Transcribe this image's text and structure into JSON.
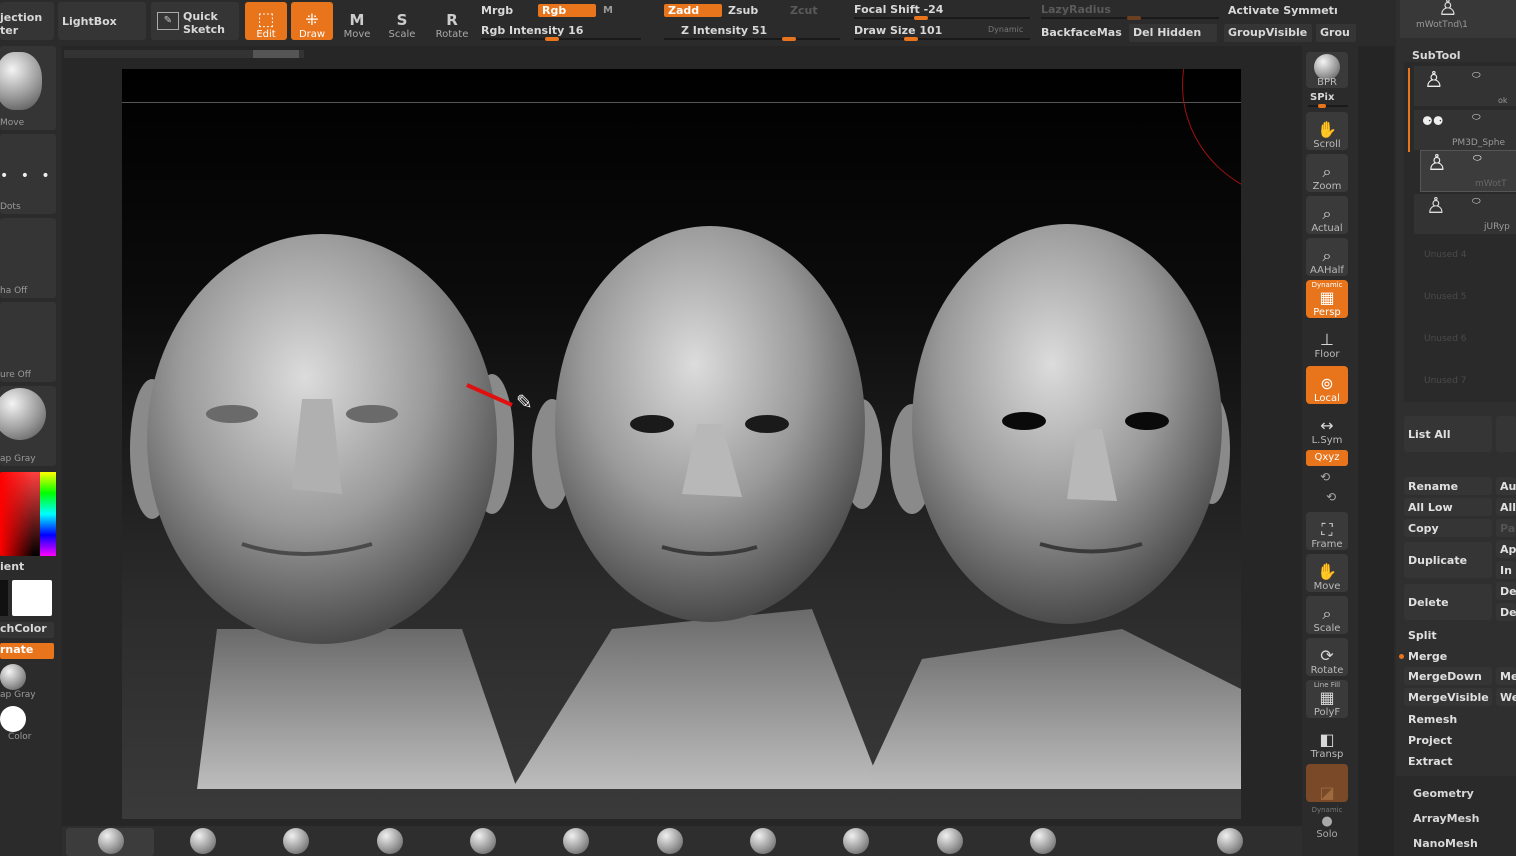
{
  "top_toolbar": {
    "projection_label": "jection",
    "projection_sub": "ter",
    "lightbox": "LightBox",
    "quick_sketch_line1": "Quick",
    "quick_sketch_line2": "Sketch",
    "edit": "Edit",
    "draw": "Draw",
    "move": "Move",
    "scale": "Scale",
    "rotate": "Rotate",
    "mrgb": "Mrgb",
    "rgb": "Rgb",
    "m": "M",
    "rgb_intensity": "Rgb  Intensity 16",
    "zadd": "Zadd",
    "zsub": "Zsub",
    "zcut": "Zcut",
    "z_intensity": "Z  Intensity 51",
    "focal_shift": "Focal  Shift -24",
    "draw_size": "Draw  Size 101",
    "dynamic": "Dynamic",
    "lazy_radius": "LazyRadius",
    "backface": "BackfaceMas",
    "del_hidden": "Del  Hidden",
    "activate_symmetry": "Activate  Symmetı",
    "group_visible": "GroupVisible",
    "grou": "Grou",
    "rgb_intensity_value": 16,
    "z_intensity_value": 51,
    "focal_shift_value": -24,
    "draw_size_value": 101
  },
  "left_panel": {
    "move_label": "Move",
    "dots_label": "Dots",
    "alpha_off": "ha  Off",
    "texture_off": "ure  Off",
    "matcap_gray": "ap  Gray",
    "gradient": "ient",
    "switch_color": "chColor",
    "alternate": "rnate",
    "matcap_gray2": "ap  Gray",
    "color": "Color"
  },
  "right_tools": {
    "bpr": "BPR",
    "spix": "SPix",
    "scroll": "Scroll",
    "zoom": "Zoom",
    "actual": "Actual",
    "aahalf": "AAHalf",
    "dynamic": "Dynamic",
    "persp": "Persp",
    "floor": "Floor",
    "local": "Local",
    "lsym": "L.Sym",
    "xyz": "Qxyz",
    "frame": "Frame",
    "move": "Move",
    "scale": "Scale",
    "rotate": "Rotate",
    "line_fill": "Line Fill",
    "polyf": "PolyF",
    "transp": "Transp",
    "dynamic2": "Dynamic",
    "solo": "Solo"
  },
  "subtool": {
    "header_top": "mWotTnd\\1",
    "title": "SubTool",
    "items": [
      {
        "name": "ok"
      },
      {
        "name": "PM3D_Sphe"
      },
      {
        "name": "mWotT"
      },
      {
        "name": "jURyp"
      },
      {
        "name": "Unused  4"
      },
      {
        "name": "Unused  5"
      },
      {
        "name": "Unused  6"
      },
      {
        "name": "Unused  7"
      }
    ],
    "list_all": "List  All",
    "rename": "Rename",
    "rename_side": "Au",
    "all_low": "All  Low",
    "all_low_side": "All",
    "copy": "Copy",
    "copy_side": "Pa",
    "duplicate": "Duplicate",
    "dup_side1": "Ap",
    "dup_side2": "In",
    "delete": "Delete",
    "del_side1": "De",
    "del_side2": "De",
    "split": "Split",
    "merge": "Merge",
    "merge_down": "MergeDown",
    "merge_down_side": "Me",
    "merge_visible": "MergeVisible",
    "merge_visible_side": "We",
    "remesh": "Remesh",
    "project": "Project",
    "extract": "Extract"
  },
  "right_menus": {
    "geometry": "Geometry",
    "arraymesh": "ArrayMesh",
    "nanomesh": "NanoMesh"
  },
  "colors": {
    "accent": "#e8741c",
    "panel": "#2a2a2a",
    "canvas": "#000000"
  }
}
